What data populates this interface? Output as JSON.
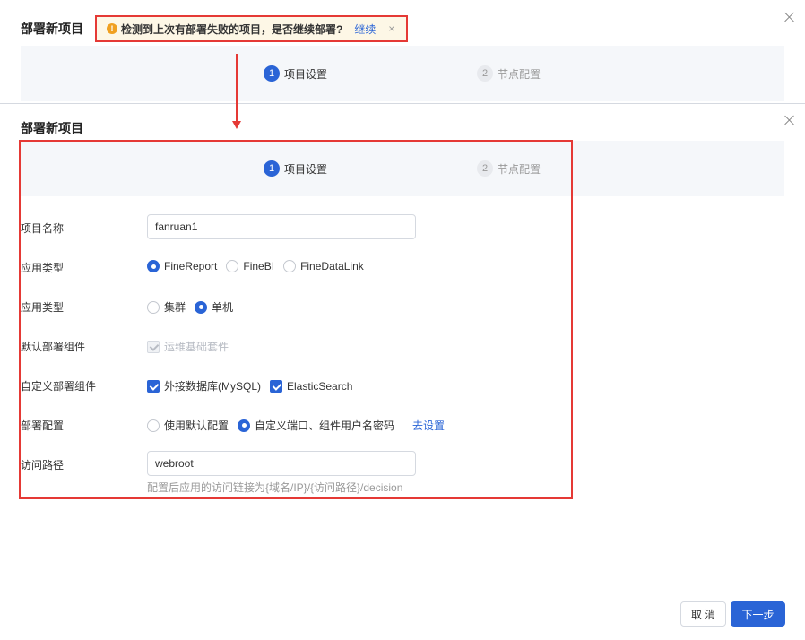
{
  "top_dialog": {
    "title": "部署新项目",
    "warning": {
      "icon": "exclamation-icon",
      "text": "检测到上次有部署失败的项目，是否继续部署?",
      "continue_label": "继续",
      "dismiss_label": "×"
    },
    "steps": [
      {
        "num": "1",
        "label": "项目设置",
        "state": "active"
      },
      {
        "num": "2",
        "label": "节点配置",
        "state": "inactive"
      }
    ]
  },
  "main_dialog": {
    "title": "部署新项目",
    "steps": [
      {
        "num": "1",
        "label": "项目设置",
        "state": "active"
      },
      {
        "num": "2",
        "label": "节点配置",
        "state": "inactive"
      }
    ],
    "form": {
      "project_name": {
        "label": "项目名称",
        "value": "fanruan1"
      },
      "app_type": {
        "label": "应用类型",
        "options": [
          "FineReport",
          "FineBI",
          "FineDataLink"
        ],
        "selected": "FineReport"
      },
      "deploy_type": {
        "label": "应用类型",
        "options": [
          "集群",
          "单机"
        ],
        "selected": "单机"
      },
      "default_components": {
        "label": "默认部署组件",
        "options": [
          "运维基础套件"
        ]
      },
      "custom_components": {
        "label": "自定义部署组件",
        "options": [
          "外接数据库(MySQL)",
          "ElasticSearch"
        ]
      },
      "deploy_config": {
        "label": "部署配置",
        "options": [
          "使用默认配置",
          "自定义端口、组件用户名密码"
        ],
        "selected": "自定义端口、组件用户名密码",
        "link": "去设置"
      },
      "access_path": {
        "label": "访问路径",
        "value": "webroot",
        "hint": "配置后应用的访问链接为{域名/IP}/{访问路径}/decision"
      }
    },
    "buttons": {
      "cancel": "取 消",
      "next": "下一步"
    }
  },
  "colors": {
    "primary": "#2a64d6",
    "highlight": "#e53935",
    "warning_bg": "#fdf7e6",
    "warning_icon": "#f0a020"
  }
}
